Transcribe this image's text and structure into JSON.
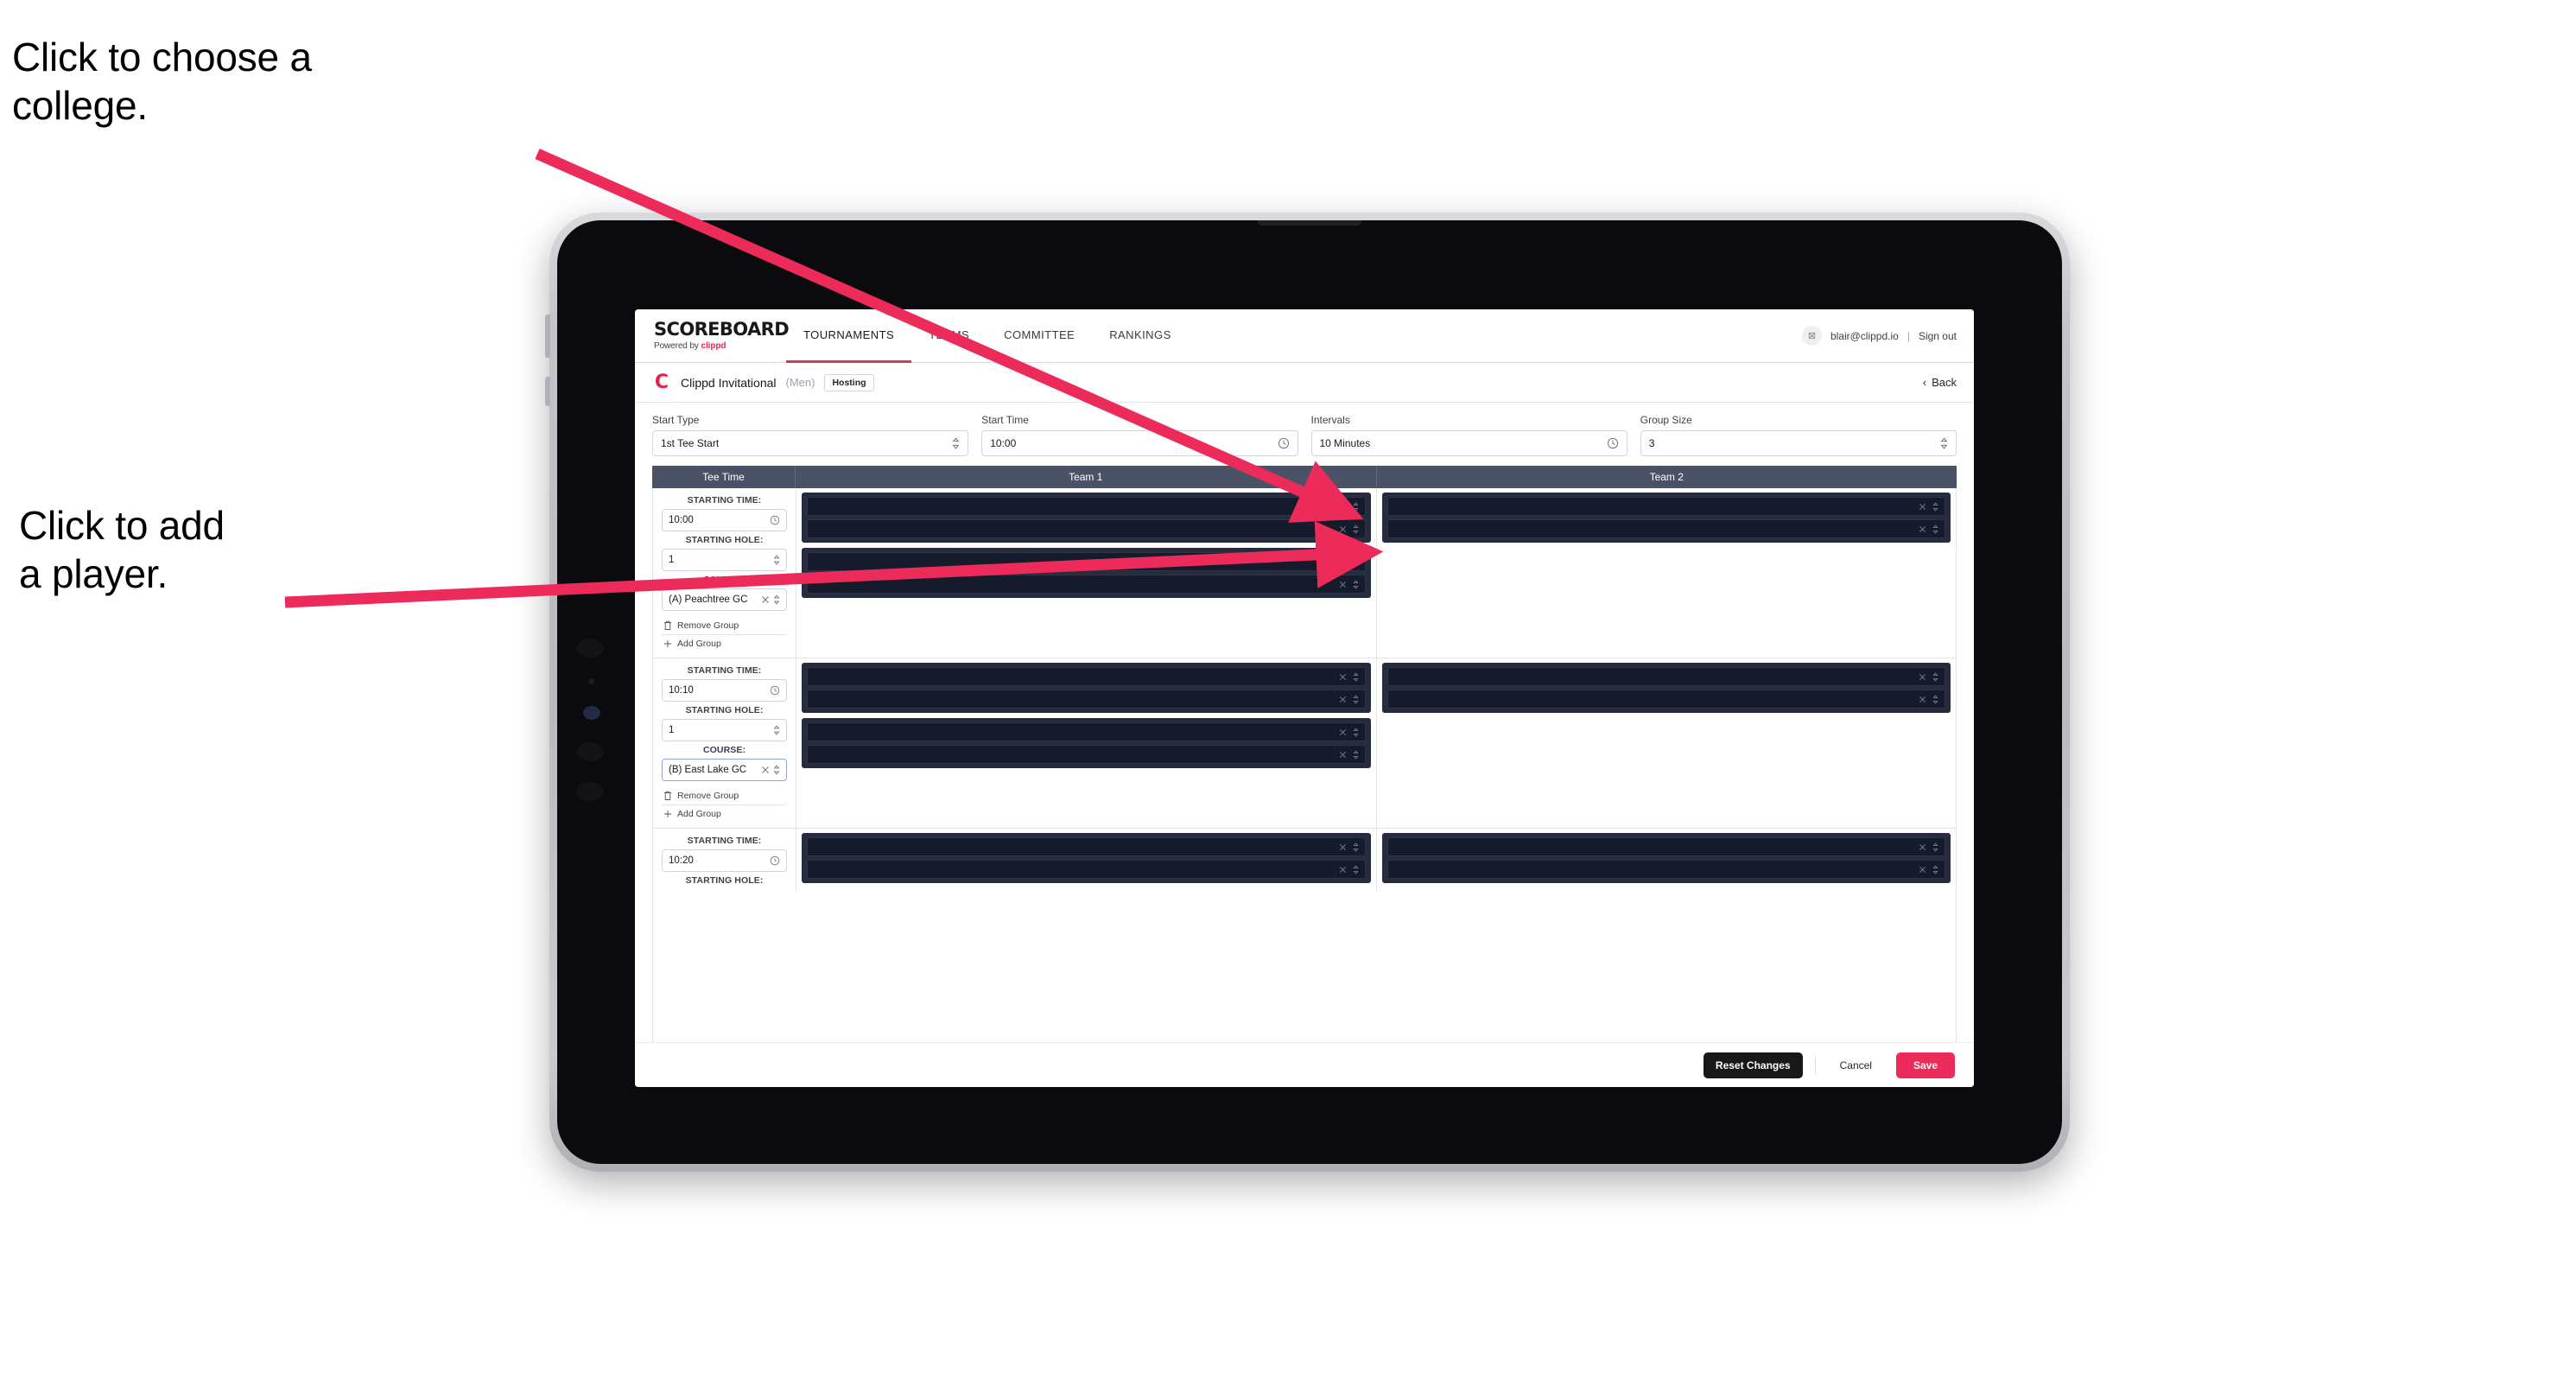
{
  "annotations": {
    "choose_college": "Click to choose a\ncollege.",
    "add_player": "Click to add\na player.",
    "arrow_color": "#ec2b5b"
  },
  "topnav": {
    "brand_title": "SCOREBOARD",
    "brand_sub_prefix": "Powered by ",
    "brand_sub_accent": "clippd",
    "tabs": [
      {
        "label": "TOURNAMENTS",
        "active": true
      },
      {
        "label": "TEAMS",
        "active": false
      },
      {
        "label": "COMMITTEE",
        "active": false
      },
      {
        "label": "RANKINGS",
        "active": false
      }
    ],
    "avatar_glyph": "⊠",
    "email": "blair@clippd.io",
    "separator": "|",
    "sign_out": "Sign out"
  },
  "tournament": {
    "logo_letter": "C",
    "name": "Clippd Invitational",
    "gender": "(Men)",
    "badge": "Hosting",
    "back_label": "Back",
    "back_chevron": "‹"
  },
  "settings": {
    "fields": [
      {
        "label": "Start Type",
        "value": "1st Tee Start",
        "control": "stepper"
      },
      {
        "label": "Start Time",
        "value": "10:00",
        "control": "clock"
      },
      {
        "label": "Intervals",
        "value": "10 Minutes",
        "control": "clock"
      },
      {
        "label": "Group Size",
        "value": "3",
        "control": "stepper"
      }
    ]
  },
  "table": {
    "columns": [
      "Tee Time",
      "Team 1",
      "Team 2"
    ],
    "labels": {
      "starting_time": "STARTING TIME:",
      "starting_hole": "STARTING HOLE:",
      "course": "COURSE:",
      "remove_group": "Remove Group",
      "add_group": "Add Group"
    },
    "groups": [
      {
        "starting_time": "10:00",
        "starting_hole": "1",
        "course": "(A) Peachtree GC",
        "course_focused": false,
        "team1": [
          {
            "slots": [
              "",
              ""
            ]
          },
          {
            "slots": [
              "",
              ""
            ]
          }
        ],
        "team2": [
          {
            "slots": [
              "",
              ""
            ]
          }
        ]
      },
      {
        "starting_time": "10:10",
        "starting_hole": "1",
        "course": "(B) East Lake GC",
        "course_focused": true,
        "team1": [
          {
            "slots": [
              "",
              ""
            ]
          },
          {
            "slots": [
              "",
              ""
            ]
          }
        ],
        "team2": [
          {
            "slots": [
              "",
              ""
            ]
          }
        ]
      },
      {
        "starting_time": "10:20",
        "starting_hole": "",
        "course": "",
        "course_focused": false,
        "team1": [
          {
            "slots": [
              "",
              ""
            ]
          }
        ],
        "team2": [
          {
            "slots": [
              "",
              ""
            ]
          }
        ]
      }
    ]
  },
  "footer": {
    "reset_label": "Reset Changes",
    "cancel_label": "Cancel",
    "save_label": "Save",
    "save_color": "#ec2b5b"
  },
  "icons": {
    "clock": "◴",
    "stepper": "⇅",
    "clear": "×",
    "trash": "Ὕ1",
    "plus": "+"
  }
}
